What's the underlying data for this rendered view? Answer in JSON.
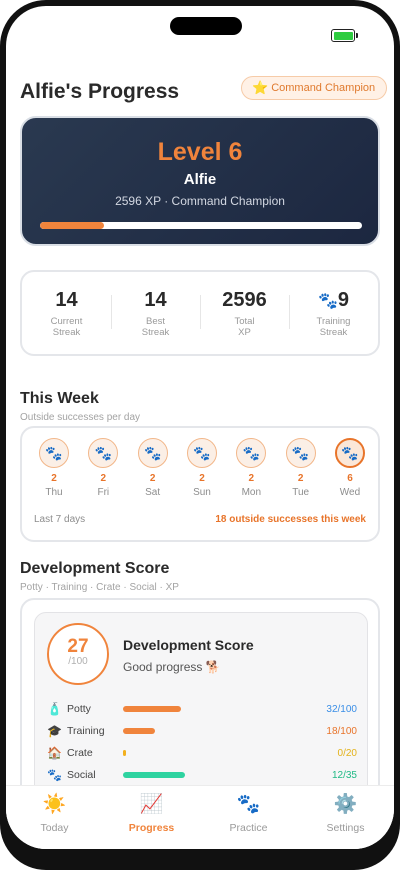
{
  "header": {
    "title": "Alfie's Progress",
    "badge_icon": "⭐",
    "badge_label": "Command Champion"
  },
  "level_card": {
    "level": "Level 6",
    "dog_name": "Alfie",
    "subtitle": "2596 XP · Command Champion",
    "progress_fraction": 0.2
  },
  "stats": [
    {
      "value": "14",
      "label": "Current Streak"
    },
    {
      "value": "14",
      "label": "Best Streak"
    },
    {
      "value": "2596",
      "label": "Total XP"
    },
    {
      "value_icon": "🐾",
      "value": "9",
      "label": "Training Streak"
    }
  ],
  "week": {
    "title": "This Week",
    "subtitle": "Outside successes per day",
    "days": [
      {
        "count": "2",
        "name": "Thu"
      },
      {
        "count": "2",
        "name": "Fri"
      },
      {
        "count": "2",
        "name": "Sat"
      },
      {
        "count": "2",
        "name": "Sun"
      },
      {
        "count": "2",
        "name": "Mon"
      },
      {
        "count": "2",
        "name": "Tue"
      },
      {
        "count": "6",
        "name": "Wed"
      }
    ],
    "footer_left": "Last 7 days",
    "footer_right": "18 outside successes this week"
  },
  "development": {
    "title": "Development Score",
    "subtitle": "Potty · Training · Crate · Social · XP",
    "card_title": "Development Score",
    "score": "27",
    "score_max": "/100",
    "status": "Good progress 🐕",
    "metrics": [
      {
        "icon": "🧴",
        "label": "Potty",
        "value": "32/100",
        "fraction": 0.32,
        "color": "#f0843c",
        "value_color": "#3a8ee6"
      },
      {
        "icon": "🎓",
        "label": "Training",
        "value": "18/100",
        "fraction": 0.18,
        "color": "#f0843c",
        "value_color": "#e8742a"
      },
      {
        "icon": "🏠",
        "label": "Crate",
        "value": "0/20",
        "fraction": 0.0,
        "color": "#f2b01e",
        "value_color": "#e3b21a"
      },
      {
        "icon": "🐾",
        "label": "Social",
        "value": "12/35",
        "fraction": 0.343,
        "color": "#2ed3a0",
        "value_color": "#1fb985"
      }
    ]
  },
  "tabs": [
    {
      "icon": "☀️",
      "label": "Today",
      "active": false
    },
    {
      "icon": "📈",
      "label": "Progress",
      "active": true
    },
    {
      "icon": "🐾",
      "label": "Practice",
      "active": false
    },
    {
      "icon": "⚙️",
      "label": "Settings",
      "active": false
    }
  ]
}
